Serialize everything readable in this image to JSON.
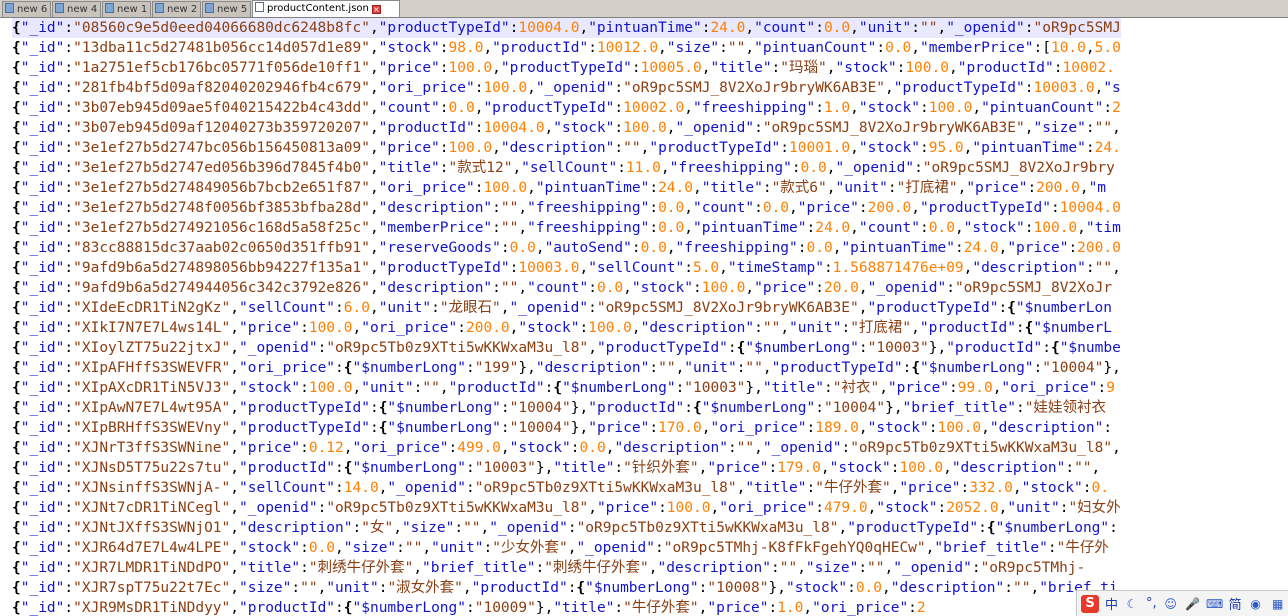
{
  "tabs": [
    {
      "label": "new 6",
      "active": false
    },
    {
      "label": "new 4",
      "active": false
    },
    {
      "label": "new 1",
      "active": false
    },
    {
      "label": "new 2",
      "active": false
    },
    {
      "label": "new 5",
      "active": false
    },
    {
      "label": "productContent.json",
      "active": true
    }
  ],
  "lines": [
    "{\"_id\":\"08560c9e5d0eed04066680dc6248b8fc\",\"productTypeId\":10004.0,\"pintuanTime\":24.0,\"count\":0.0,\"unit\":\"\",\"_openid\":\"oR9pc5SMJ",
    "{\"_id\":\"13dba11c5d27481b056cc14d057d1e89\",\"stock\":98.0,\"productId\":10012.0,\"size\":\"\",\"pintuanCount\":0.0,\"memberPrice\":[10.0,5.0",
    "{\"_id\":\"1a2751ef5cb176bc05771f056de10ff1\",\"price\":100.0,\"productTypeId\":10005.0,\"title\":\"玛瑙\",\"stock\":100.0,\"productId\":10002.",
    "{\"_id\":\"281fb4bf5d09af82040202946fb4c679\",\"ori_price\":100.0,\"_openid\":\"oR9pc5SMJ_8V2XoJr9bryWK6AB3E\",\"productTypeId\":10003.0,\"s",
    "{\"_id\":\"3b07eb945d09ae5f040215422b4c43dd\",\"count\":0.0,\"productTypeId\":10002.0,\"freeshipping\":1.0,\"stock\":100.0,\"pintuanCount\":2",
    "{\"_id\":\"3b07eb945d09af12040273b359720207\",\"productId\":10004.0,\"stock\":100.0,\"_openid\":\"oR9pc5SMJ_8V2XoJr9bryWK6AB3E\",\"size\":\"\",",
    "{\"_id\":\"3e1ef27b5d2747bc056b156450813a09\",\"price\":100.0,\"description\":\"\",\"productTypeId\":10001.0,\"stock\":95.0,\"pintuanTime\":24.",
    "{\"_id\":\"3e1ef27b5d2747ed056b396d7845f4b0\",\"title\":\"款式12\",\"sellCount\":11.0,\"freeshipping\":0.0,\"_openid\":\"oR9pc5SMJ_8V2XoJr9bry",
    "{\"_id\":\"3e1ef27b5d274849056b7bcb2e651f87\",\"ori_price\":100.0,\"pintuanTime\":24.0,\"title\":\"款式6\",\"unit\":\"打底裙\",\"price\":200.0,\"m",
    "{\"_id\":\"3e1ef27b5d2748f0056bf3853bfba28d\",\"description\":\"\",\"freeshipping\":0.0,\"count\":0.0,\"price\":200.0,\"productTypeId\":10004.0",
    "{\"_id\":\"3e1ef27b5d274921056c168d5a58f25c\",\"memberPrice\":\"\",\"freeshipping\":0.0,\"pintuanTime\":24.0,\"count\":0.0,\"stock\":100.0,\"tim",
    "{\"_id\":\"83cc88815dc37aab02c0650d351ffb91\",\"reserveGoods\":0.0,\"autoSend\":0.0,\"freeshipping\":0.0,\"pintuanTime\":24.0,\"price\":200.0",
    "{\"_id\":\"9afd9b6a5d274898056bb94227f135a1\",\"productTypeId\":10003.0,\"sellCount\":5.0,\"timeStamp\":1.568871476e+09,\"description\":\"\",",
    "{\"_id\":\"9afd9b6a5d274944056c342c3792e826\",\"description\":\"\",\"count\":0.0,\"stock\":100.0,\"price\":20.0,\"_openid\":\"oR9pc5SMJ_8V2XoJr",
    "{\"_id\":\"XIdeEcDR1TiN2gKz\",\"sellCount\":6.0,\"unit\":\"龙眼石\",\"_openid\":\"oR9pc5SMJ_8V2XoJr9bryWK6AB3E\",\"productTypeId\":{\"$numberLon",
    "{\"_id\":\"XIkI7N7E7L4ws14L\",\"price\":100.0,\"ori_price\":200.0,\"stock\":100.0,\"description\":\"\",\"unit\":\"打底裙\",\"productId\":{\"$numberL",
    "{\"_id\":\"XIoylZT75u22jtxJ\",\"_openid\":\"oR9pc5Tb0z9XTti5wKKWxaM3u_l8\",\"productTypeId\":{\"$numberLong\":\"10003\"},\"productId\":{\"$numbe",
    "{\"_id\":\"XIpAFHffS3SWEVFR\",\"ori_price\":{\"$numberLong\":\"199\"},\"description\":\"\",\"unit\":\"\",\"productTypeId\":{\"$numberLong\":\"10004\"},",
    "{\"_id\":\"XIpAXcDR1TiN5VJ3\",\"stock\":100.0,\"unit\":\"\",\"productId\":{\"$numberLong\":\"10003\"},\"title\":\"衬衣\",\"price\":99.0,\"ori_price\":9",
    "{\"_id\":\"XIpAwN7E7L4wt95A\",\"productTypeId\":{\"$numberLong\":\"10004\"},\"productId\":{\"$numberLong\":\"10004\"},\"brief_title\":\"娃娃领衬衣",
    "{\"_id\":\"XIpBRHffS3SWEVny\",\"productTypeId\":{\"$numberLong\":\"10004\"},\"price\":170.0,\"ori_price\":189.0,\"stock\":100.0,\"description\":",
    "{\"_id\":\"XJNrT3ffS3SWNine\",\"price\":0.12,\"ori_price\":499.0,\"stock\":0.0,\"description\":\"\",\"_openid\":\"oR9pc5Tb0z9XTti5wKKWxaM3u_l8\",",
    "{\"_id\":\"XJNsD5T75u22s7tu\",\"productId\":{\"$numberLong\":\"10003\"},\"title\":\"针织外套\",\"price\":179.0,\"stock\":100.0,\"description\":\"\",",
    "{\"_id\":\"XJNsinffS3SWNjA-\",\"sellCount\":14.0,\"_openid\":\"oR9pc5Tb0z9XTti5wKKWxaM3u_l8\",\"title\":\"牛仔外套\",\"price\":332.0,\"stock\":0.",
    "{\"_id\":\"XJNt7cDR1TiNCegl\",\"_openid\":\"oR9pc5Tb0z9XTti5wKKWxaM3u_l8\",\"price\":100.0,\"ori_price\":479.0,\"stock\":2052.0,\"unit\":\"妇女外",
    "{\"_id\":\"XJNtJXffS3SWNjO1\",\"description\":\"女\",\"size\":\"\",\"_openid\":\"oR9pc5Tb0z9XTti5wKKWxaM3u_l8\",\"productTypeId\":{\"$numberLong\":",
    "{\"_id\":\"XJR64d7E7L4w4LPE\",\"stock\":0.0,\"size\":\"\",\"unit\":\"少女外套\",\"_openid\":\"oR9pc5TMhj-K8fFkFgehYQ0qHECw\",\"brief_title\":\"牛仔外",
    "{\"_id\":\"XJR7LMDR1TiNDdPO\",\"title\":\"刺绣牛仔外套\",\"brief_title\":\"刺绣牛仔外套\",\"description\":\"\",\"size\":\"\",\"_openid\":\"oR9pc5TMhj-",
    "{\"_id\":\"XJR7spT75u22t7Ec\",\"size\":\"\",\"unit\":\"淑女外套\",\"productId\":{\"$numberLong\":\"10008\"},\"stock\":0.0,\"description\":\"\",\"brief_ti",
    "{\"_id\":\"XJR9MsDR1TiNDdyy\",\"productId\":{\"$numberLong\":\"10009\"},\"title\":\"牛仔外套\",\"price\":1.0,\"ori_price\":2"
  ],
  "tray": {
    "ime_logo": "S",
    "lang": "中",
    "punct": "°,",
    "mode": "简"
  }
}
